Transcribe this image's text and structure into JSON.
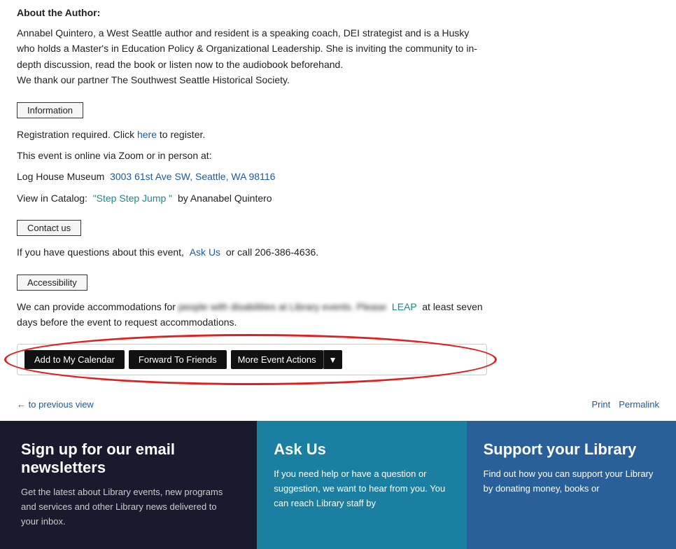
{
  "author_section": {
    "title": "About the Author:",
    "bio": "Annabel Quintero, a West Seattle author and resident is a speaking coach, DEI strategist and is a Husky who holds a Master's in Education Policy & Organizational Leadership. She is inviting the community to in-depth discussion, read the book or listen now to the audiobook beforehand.",
    "thanks": "We thank our partner The Southwest Seattle Historical Society."
  },
  "information_section": {
    "heading": "Information",
    "registration_text": "Registration required. Click",
    "here_link": "here",
    "register_text": "to register.",
    "online_text": "This event is online via Zoom or in person at:",
    "venue_name": "Log House Museum",
    "venue_address": "3003 61st Ave SW, Seattle, WA 98116",
    "catalog_label": "View in Catalog:",
    "catalog_link": "\"Step Step Jump \"",
    "catalog_author": "by Ananabel Quintero"
  },
  "contact_section": {
    "heading": "Contact us",
    "text_before": "If you have questions about this event,",
    "ask_us_link": "Ask Us",
    "text_after": "or call 206-386-4636."
  },
  "accessibility_section": {
    "heading": "Accessibility",
    "text_before": "We can provide accommodations for people with disabilities at Library events. Please",
    "leap_link": "LEAP",
    "text_after": "at least seven days before the event to request accommodations."
  },
  "action_bar": {
    "add_calendar": "Add to My Calendar",
    "forward_friends": "Forward To Friends",
    "more_event_actions": "More Event Actions"
  },
  "nav_links": {
    "back": "← to previous view",
    "print": "Print",
    "permalink": "Permalink"
  },
  "footer": {
    "newsletter": {
      "heading": "Sign up for our email newsletters",
      "body": "Get the latest about Library events, new programs and services and other Library news delivered to your inbox."
    },
    "askus": {
      "heading": "Ask Us",
      "body": "If you need help or have a question or suggestion, we want to hear from you. You can reach Library staff by"
    },
    "support": {
      "heading": "Support your Library",
      "body": "Find out how you can support your Library by donating money, books or"
    }
  }
}
